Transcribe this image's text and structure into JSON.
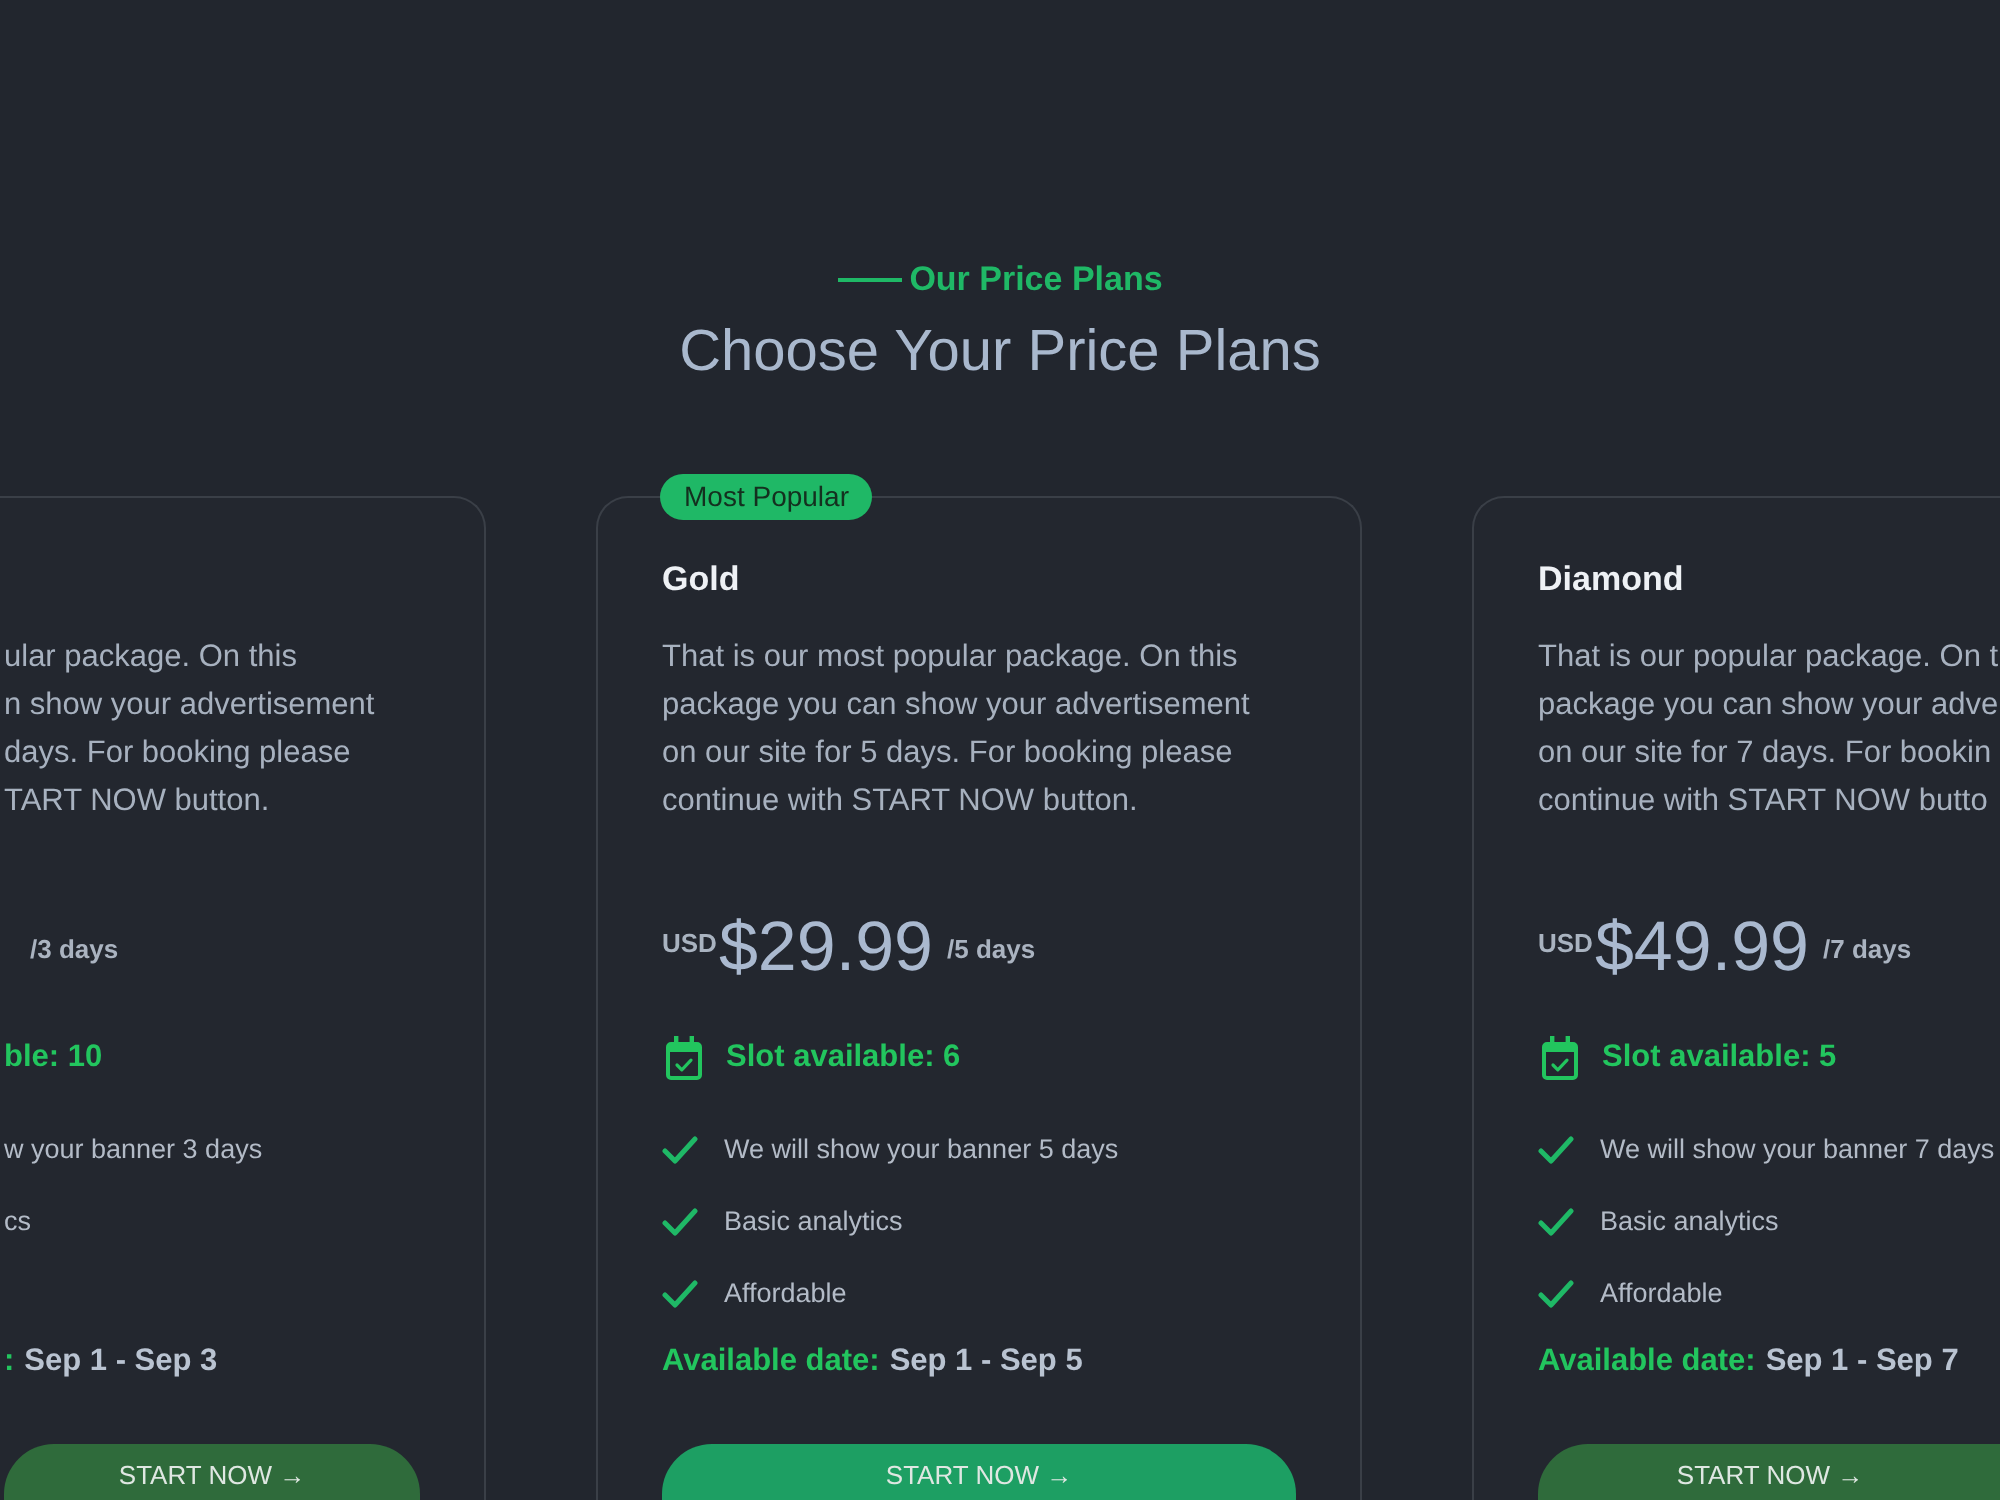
{
  "header": {
    "eyebrow": "Our Price Plans",
    "title": "Choose Your Price Plans"
  },
  "plans": [
    {
      "kind": "left_cut",
      "featured": false,
      "description": "ular package. On this\nn show your advertisement\ndays. For booking please\nTART NOW button.",
      "period": "/3 days",
      "slots": "ble: 10",
      "features": [
        "w your banner 3 days",
        "cs"
      ],
      "date_label": ":",
      "date_value": "Sep 1 - Sep 3",
      "button": "START NOW →"
    },
    {
      "kind": "full",
      "featured": true,
      "badge": "Most Popular",
      "title": "Gold",
      "description": "That is our most popular package. On this package you can show your advertisement on our site for 5 days. For booking please continue with START NOW button.",
      "currency": "USD",
      "price": "$29.99",
      "period": "/5 days",
      "slots": "Slot available: 6",
      "features": [
        "We will show your banner 5 days",
        "Basic analytics",
        "Affordable"
      ],
      "date_label": "Available date:",
      "date_value": "Sep 1 - Sep 5",
      "button": "START NOW →"
    },
    {
      "kind": "right_cut",
      "featured": false,
      "title": "Diamond",
      "description": "That is our popular package. On t\npackage you can show your adve\non our site for 7 days. For bookin\ncontinue with START NOW butto",
      "currency": "USD",
      "price": "$49.99",
      "period": "/7 days",
      "slots": "Slot available: 5",
      "features": [
        "We will show your banner 7 days",
        "Basic analytics",
        "Affordable"
      ],
      "date_label": "Available date:",
      "date_value": "Sep 1 - Sep 7",
      "button": "START NOW →"
    }
  ]
}
